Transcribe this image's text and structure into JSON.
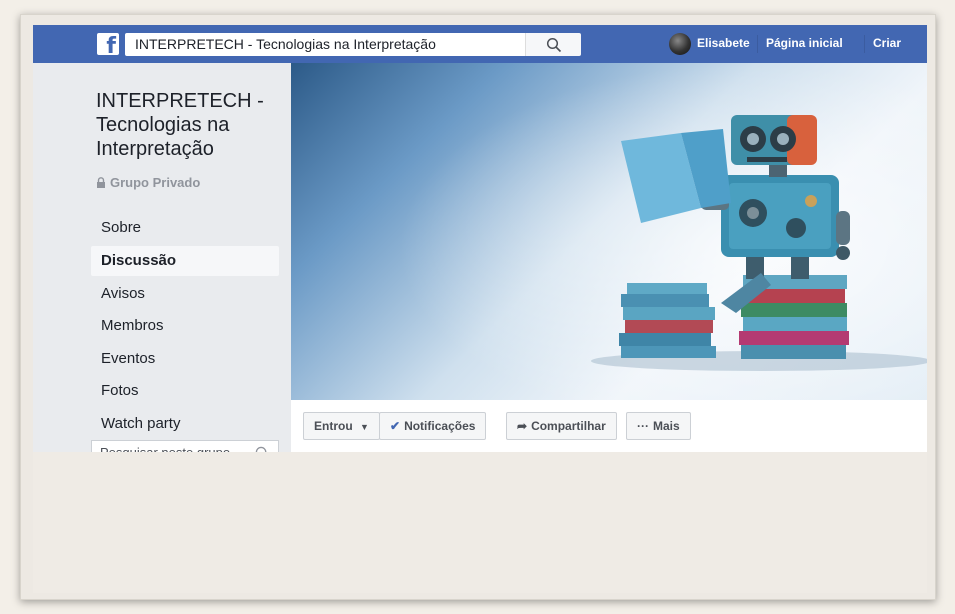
{
  "topbar": {
    "search_value": "INTERPRETECH - Tecnologias na Interpretação",
    "user_name": "Elisabete",
    "home_label": "Página inicial",
    "create_label": "Criar"
  },
  "group": {
    "title": "INTERPRETECH - Tecnologias na Interpretação",
    "privacy": "Grupo Privado"
  },
  "sidebar": {
    "items": [
      {
        "label": "Sobre"
      },
      {
        "label": "Discussão"
      },
      {
        "label": "Avisos"
      },
      {
        "label": "Membros"
      },
      {
        "label": "Eventos"
      },
      {
        "label": "Fotos"
      },
      {
        "label": "Watch party"
      }
    ],
    "active_index": 1,
    "search_placeholder": "Pesquisar neste grupo"
  },
  "actions": {
    "joined_label": "Entrou",
    "notifications_label": "Notificações",
    "share_label": "Compartilhar",
    "more_label": "Mais"
  },
  "colors": {
    "brand_blue": "#4267b2",
    "sidebar_bg": "#e9ebee"
  }
}
